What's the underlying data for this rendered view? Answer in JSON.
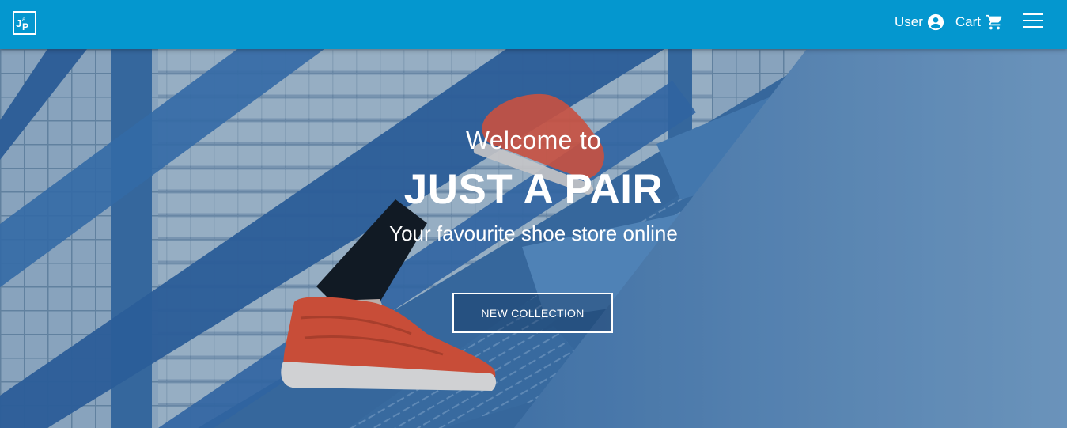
{
  "navbar": {
    "logo_text": "JaP",
    "user_label": "User",
    "cart_label": "Cart",
    "background": "#0497cf"
  },
  "hero": {
    "welcome": "Welcome to",
    "brand": "JUST A PAIR",
    "tagline": "Your favourite shoe store online",
    "cta_label": "NEW COLLECTION"
  },
  "icons": [
    "account-circle-icon",
    "shopping-cart-icon",
    "hamburger-menu-icon"
  ]
}
